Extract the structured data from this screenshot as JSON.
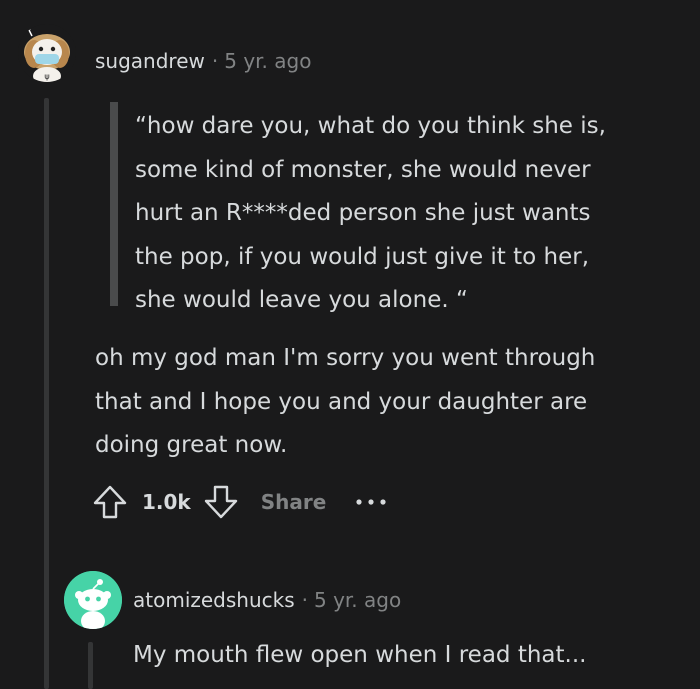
{
  "comment": {
    "username": "sugandrew",
    "separator": "·",
    "age": "5 yr. ago",
    "quote_lines": [
      "“how dare you, what do you think she is,",
      "some kind of monster, she would never",
      "hurt an R****ded person she just wants",
      "the pop, if you would just give it to her,",
      "she would leave you alone. “"
    ],
    "body_lines": [
      "oh my god man I'm sorry you went through",
      "that and I hope you and your daughter are",
      "doing great now."
    ],
    "actions": {
      "score": "1.0k",
      "share_label": "Share",
      "upvote_icon": "upvote-icon",
      "downvote_icon": "downvote-icon",
      "more_icon": "more-options-icon"
    }
  },
  "reply": {
    "username": "atomizedshucks",
    "separator": "·",
    "age": "5 yr. ago",
    "text": "My mouth flew open when I read that...",
    "avatar_color": "#46d3a7"
  },
  "colors": {
    "background": "#1a1a1b",
    "text": "#d7dadc",
    "muted": "#818384",
    "thread_line": "#343536"
  }
}
